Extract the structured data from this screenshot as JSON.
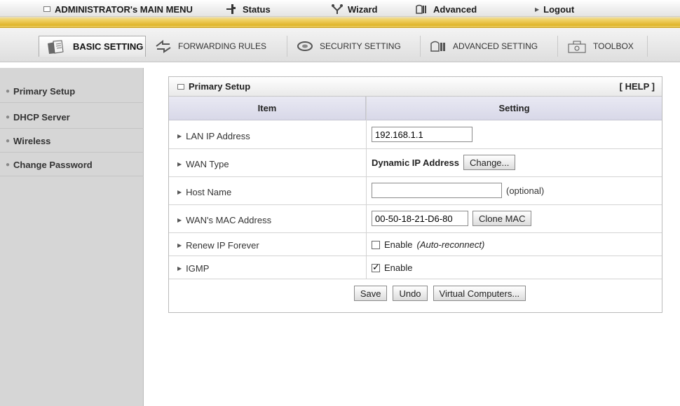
{
  "topmenu": {
    "main_menu": "ADMINISTRATOR's MAIN MENU",
    "status": "Status",
    "wizard": "Wizard",
    "advanced": "Advanced",
    "logout": "Logout"
  },
  "tabs": [
    {
      "label": "BASIC SETTING",
      "active": true,
      "icon": "folder-docs-icon"
    },
    {
      "label": "FORWARDING RULES",
      "active": false,
      "icon": "arrows-icon"
    },
    {
      "label": "SECURITY SETTING",
      "active": false,
      "icon": "security-icon"
    },
    {
      "label": "ADVANCED SETTING",
      "active": false,
      "icon": "advanced-icon"
    },
    {
      "label": "TOOLBOX",
      "active": false,
      "icon": "toolbox-icon"
    }
  ],
  "sidebar": {
    "items": [
      {
        "label": "Primary Setup"
      },
      {
        "label": "DHCP Server"
      },
      {
        "label": "Wireless"
      },
      {
        "label": "Change Password"
      }
    ]
  },
  "panel": {
    "title": "Primary Setup",
    "help": "[ HELP ]",
    "col_item": "Item",
    "col_setting": "Setting"
  },
  "rows": {
    "lan_ip": {
      "label": "LAN IP Address",
      "value": "192.168.1.1"
    },
    "wan_type": {
      "label": "WAN Type",
      "value": "Dynamic IP Address",
      "button": "Change..."
    },
    "host_name": {
      "label": "Host Name",
      "value": "",
      "hint": "(optional)"
    },
    "wan_mac": {
      "label": "WAN's MAC Address",
      "value": "00-50-18-21-D6-80",
      "button": "Clone MAC"
    },
    "renew_ip": {
      "label": "Renew IP Forever",
      "checkbox_label": "Enable",
      "note": "(Auto-reconnect)",
      "checked": false
    },
    "igmp": {
      "label": "IGMP",
      "checkbox_label": "Enable",
      "checked": true
    }
  },
  "actions": {
    "save": "Save",
    "undo": "Undo",
    "virtual": "Virtual Computers..."
  },
  "colors": {
    "accent_gold": "#e0b52a",
    "sidebar_bg": "#d6d6d6",
    "header_bg": "#d8d8e8"
  }
}
